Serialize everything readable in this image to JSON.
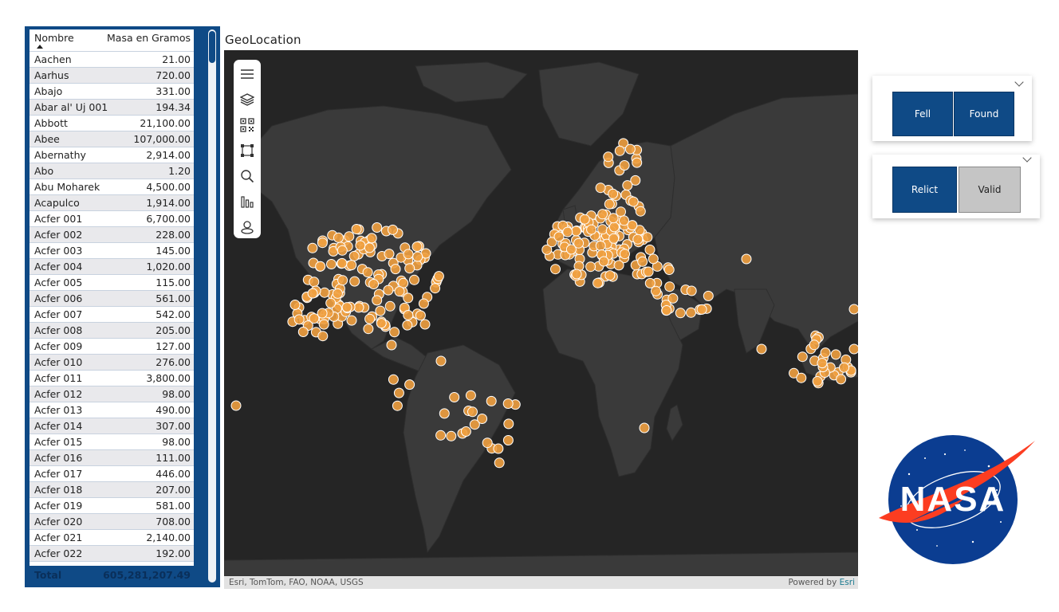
{
  "table": {
    "columns": {
      "name": "Nombre",
      "mass": "Masa en Gramos"
    },
    "rows": [
      {
        "name": "Aachen",
        "mass": "21.00"
      },
      {
        "name": "Aarhus",
        "mass": "720.00"
      },
      {
        "name": "Abajo",
        "mass": "331.00"
      },
      {
        "name": "Abar al' Uj 001",
        "mass": "194.34"
      },
      {
        "name": "Abbott",
        "mass": "21,100.00"
      },
      {
        "name": "Abee",
        "mass": "107,000.00"
      },
      {
        "name": "Abernathy",
        "mass": "2,914.00"
      },
      {
        "name": "Abo",
        "mass": "1.20"
      },
      {
        "name": "Abu Moharek",
        "mass": "4,500.00"
      },
      {
        "name": "Acapulco",
        "mass": "1,914.00"
      },
      {
        "name": "Acfer 001",
        "mass": "6,700.00"
      },
      {
        "name": "Acfer 002",
        "mass": "228.00"
      },
      {
        "name": "Acfer 003",
        "mass": "145.00"
      },
      {
        "name": "Acfer 004",
        "mass": "1,020.00"
      },
      {
        "name": "Acfer 005",
        "mass": "115.00"
      },
      {
        "name": "Acfer 006",
        "mass": "561.00"
      },
      {
        "name": "Acfer 007",
        "mass": "542.00"
      },
      {
        "name": "Acfer 008",
        "mass": "205.00"
      },
      {
        "name": "Acfer 009",
        "mass": "127.00"
      },
      {
        "name": "Acfer 010",
        "mass": "276.00"
      },
      {
        "name": "Acfer 011",
        "mass": "3,800.00"
      },
      {
        "name": "Acfer 012",
        "mass": "98.00"
      },
      {
        "name": "Acfer 013",
        "mass": "490.00"
      },
      {
        "name": "Acfer 014",
        "mass": "307.00"
      },
      {
        "name": "Acfer 015",
        "mass": "98.00"
      },
      {
        "name": "Acfer 016",
        "mass": "111.00"
      },
      {
        "name": "Acfer 017",
        "mass": "446.00"
      },
      {
        "name": "Acfer 018",
        "mass": "207.00"
      },
      {
        "name": "Acfer 019",
        "mass": "581.00"
      },
      {
        "name": "Acfer 020",
        "mass": "708.00"
      },
      {
        "name": "Acfer 021",
        "mass": "2,140.00"
      },
      {
        "name": "Acfer 022",
        "mass": "192.00"
      }
    ],
    "total": {
      "label": "Total",
      "value": "605,281,207.49"
    }
  },
  "map": {
    "title": "GeoLocation",
    "attribution": "Esri, TomTom, FAO, NOAA, USGS",
    "powered_prefix": "Powered by",
    "powered_brand": "Esri",
    "toolbar_icons": [
      "menu-icon",
      "layers-icon",
      "qr-code-icon",
      "selection-icon",
      "search-icon",
      "bar-chart-icon",
      "person-pin-icon"
    ],
    "colors": {
      "ocean": "#252525",
      "land": "#3a3a3a",
      "point": "#f0a040",
      "point_stroke": "#ffffff"
    }
  },
  "slicer_fall": {
    "options": [
      {
        "label": "Fell",
        "selected": true
      },
      {
        "label": "Found",
        "selected": true
      }
    ]
  },
  "slicer_class": {
    "options": [
      {
        "label": "Relict",
        "selected": true
      },
      {
        "label": "Valid",
        "selected": false
      }
    ]
  },
  "logo": {
    "text": "NASA"
  },
  "colors": {
    "accent": "#0f4a86",
    "nasa_blue": "#0b3d91",
    "nasa_red": "#fc3d21"
  }
}
